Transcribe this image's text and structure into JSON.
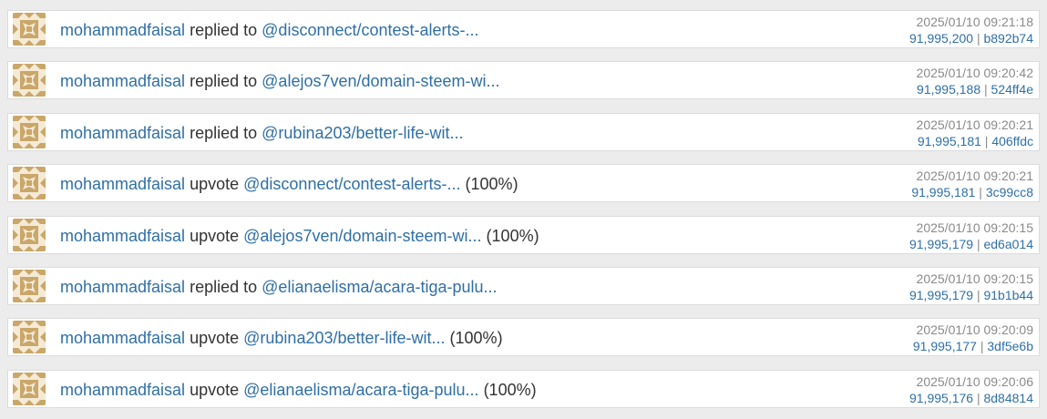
{
  "colors": {
    "link": "#2f6fa6",
    "text": "#333333",
    "muted": "#8a8a8a",
    "avatar_gold": "#c9a76a",
    "avatar_light": "#f4ead6"
  },
  "avatar_icon": "identicon-avatar",
  "feed": [
    {
      "user": "mohammadfaisal",
      "action": "replied to",
      "target": "@disconnect/contest-alerts-...",
      "suffix": "",
      "time": "2025/01/10 09:21:18",
      "block": "91,995,200",
      "separator": " | ",
      "tx": "b892b74"
    },
    {
      "user": "mohammadfaisal",
      "action": "replied to",
      "target": "@alejos7ven/domain-steem-wi...",
      "suffix": "",
      "time": "2025/01/10 09:20:42",
      "block": "91,995,188",
      "separator": " | ",
      "tx": "524ff4e"
    },
    {
      "user": "mohammadfaisal",
      "action": "replied to",
      "target": "@rubina203/better-life-wit...",
      "suffix": "",
      "time": "2025/01/10 09:20:21",
      "block": "91,995,181",
      "separator": " | ",
      "tx": "406ffdc"
    },
    {
      "user": "mohammadfaisal",
      "action": "upvote",
      "target": "@disconnect/contest-alerts-...",
      "suffix": "(100%)",
      "time": "2025/01/10 09:20:21",
      "block": "91,995,181",
      "separator": " | ",
      "tx": "3c99cc8"
    },
    {
      "user": "mohammadfaisal",
      "action": "upvote",
      "target": "@alejos7ven/domain-steem-wi...",
      "suffix": "(100%)",
      "time": "2025/01/10 09:20:15",
      "block": "91,995,179",
      "separator": " | ",
      "tx": "ed6a014"
    },
    {
      "user": "mohammadfaisal",
      "action": "replied to",
      "target": "@elianaelisma/acara-tiga-pulu...",
      "suffix": "",
      "time": "2025/01/10 09:20:15",
      "block": "91,995,179",
      "separator": " | ",
      "tx": "91b1b44"
    },
    {
      "user": "mohammadfaisal",
      "action": "upvote",
      "target": "@rubina203/better-life-wit...",
      "suffix": "(100%)",
      "time": "2025/01/10 09:20:09",
      "block": "91,995,177",
      "separator": " | ",
      "tx": "3df5e6b"
    },
    {
      "user": "mohammadfaisal",
      "action": "upvote",
      "target": "@elianaelisma/acara-tiga-pulu...",
      "suffix": "(100%)",
      "time": "2025/01/10 09:20:06",
      "block": "91,995,176",
      "separator": " | ",
      "tx": "8d84814"
    }
  ]
}
